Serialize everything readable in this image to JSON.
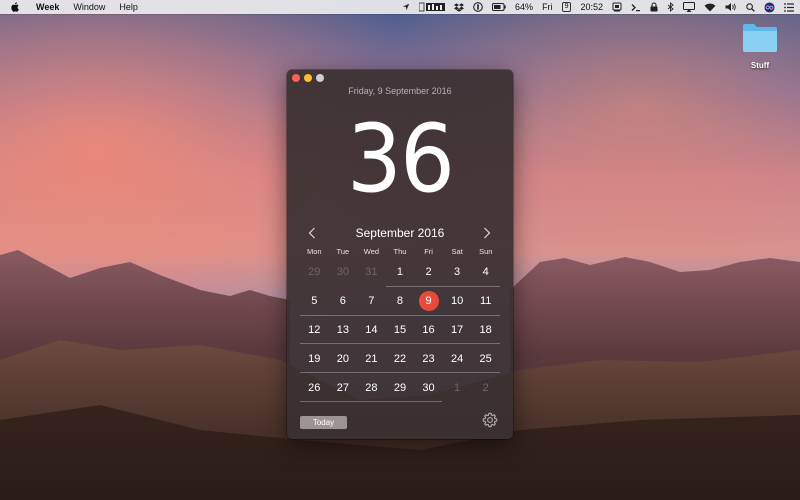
{
  "menubar": {
    "apple_icon": "apple-icon",
    "app_name": "Week",
    "menus": [
      "Window",
      "Help"
    ],
    "battery_percent": "64%",
    "day": "Fri",
    "date_box": "9",
    "time": "20:52"
  },
  "desktop": {
    "folder_label": "Stuff"
  },
  "window": {
    "full_date": "Friday, 9 September 2016",
    "week_number": "36",
    "month_title": "September 2016",
    "weekdays": [
      "Mon",
      "Tue",
      "Wed",
      "Thu",
      "Fri",
      "Sat",
      "Sun"
    ],
    "weeks": [
      [
        "29",
        "30",
        "31",
        "1",
        "2",
        "3",
        "4"
      ],
      [
        "5",
        "6",
        "7",
        "8",
        "9",
        "10",
        "11"
      ],
      [
        "12",
        "13",
        "14",
        "15",
        "16",
        "17",
        "18"
      ],
      [
        "19",
        "20",
        "21",
        "22",
        "23",
        "24",
        "25"
      ],
      [
        "26",
        "27",
        "28",
        "29",
        "30",
        "1",
        "2"
      ]
    ],
    "today_button": "Today",
    "selected_color": "#e84a3c"
  }
}
